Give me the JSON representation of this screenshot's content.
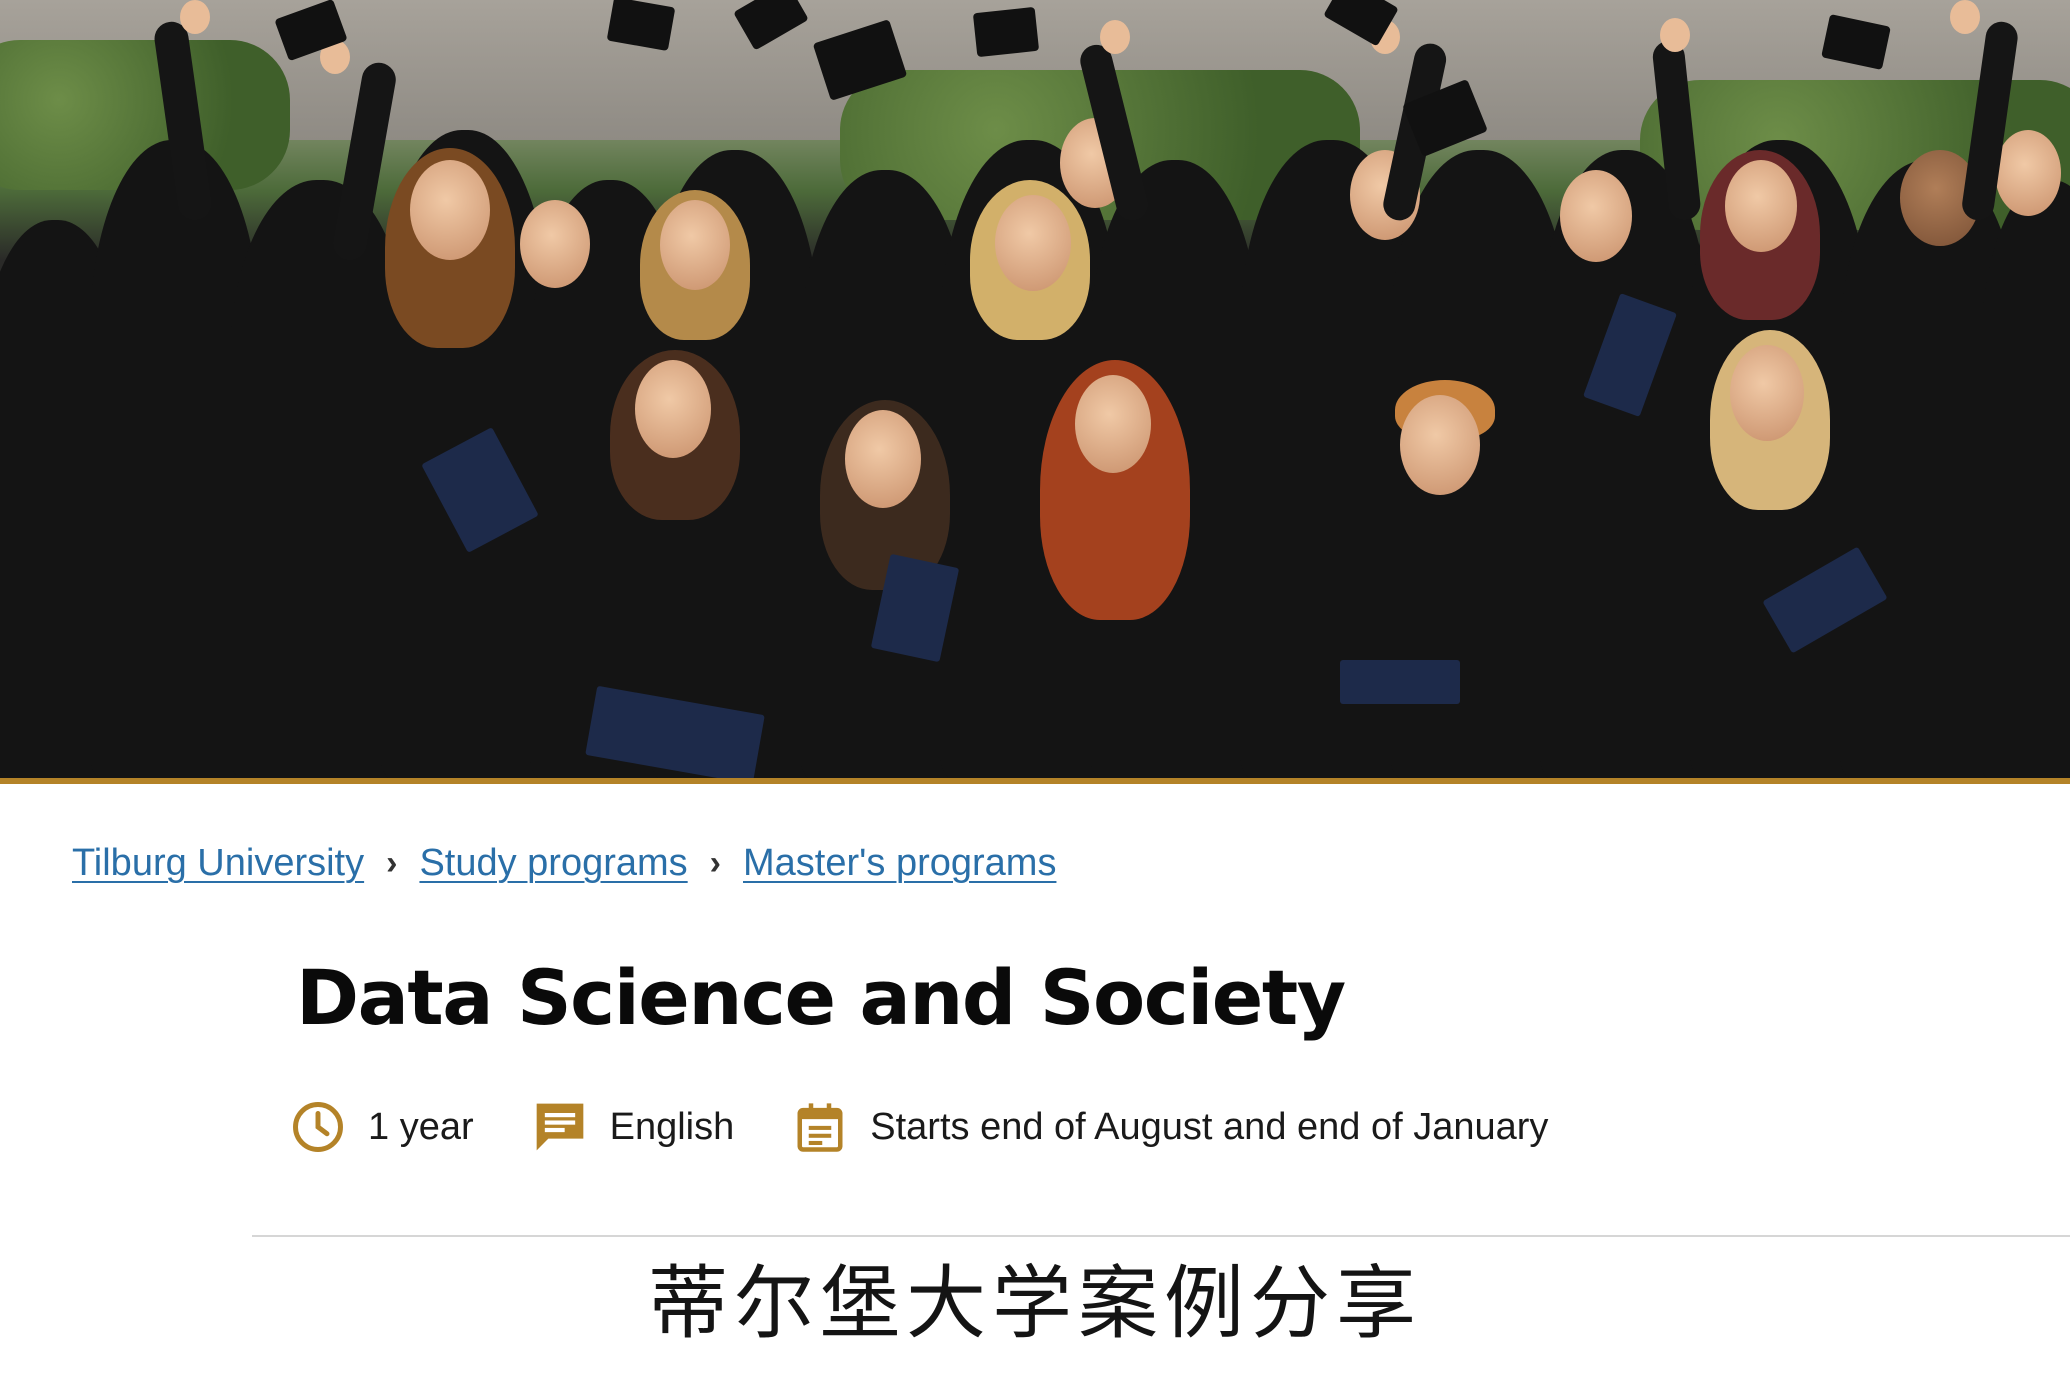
{
  "hero": {
    "accent_color": "#b48328"
  },
  "breadcrumb": {
    "items": [
      {
        "label": "Tilburg University"
      },
      {
        "label": "Study programs"
      },
      {
        "label": "Master's programs"
      }
    ],
    "separator": "›",
    "link_color": "#2a6fa8"
  },
  "program": {
    "title": "Data Science and Society",
    "duration": "1 year",
    "language": "English",
    "start": "Starts end of August and end of January",
    "icon_color": "#b48328",
    "icons": [
      "clock-icon",
      "chat-icon",
      "calendar-icon"
    ]
  },
  "caption": {
    "text": "蒂尔堡大学案例分享"
  }
}
